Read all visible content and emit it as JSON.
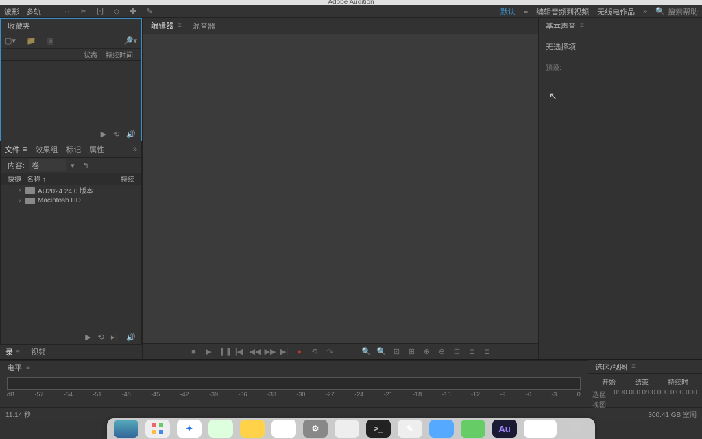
{
  "app_title": "Adobe Audition",
  "toolbar": {
    "mode_waveform": "波形",
    "mode_multitrack": "多轨",
    "workspace_default": "默认",
    "workspace_edit_video": "编辑音频到视频",
    "workspace_radio": "无线电作品",
    "search_help_placeholder": "搜索帮助"
  },
  "favorites": {
    "title": "收藏夹",
    "col_status": "状态",
    "col_duration": "持续时间"
  },
  "files": {
    "tab_files": "文件",
    "tab_effects": "效果组",
    "tab_markers": "标记",
    "tab_properties": "属性",
    "content_label": "内容:",
    "content_value": "卷",
    "col_quick": "快捷",
    "col_name": "名称 ↑",
    "col_duration": "持续",
    "rows": [
      {
        "name": "AU2024 24.0 版本"
      },
      {
        "name": "Macintosh HD"
      }
    ]
  },
  "left_bottom": {
    "tab_history": "录",
    "tab_video": "视频"
  },
  "center": {
    "tab_editor": "编辑器",
    "tab_mixer": "混音器"
  },
  "levels": {
    "title": "电平",
    "ticks": [
      "dB",
      "-57",
      "-54",
      "-51",
      "-48",
      "-45",
      "-42",
      "-39",
      "-36",
      "-33",
      "-30",
      "-27",
      "-24",
      "-21",
      "-18",
      "-15",
      "-12",
      "-9",
      "-6",
      "-3",
      "0"
    ]
  },
  "right": {
    "title": "基本声音",
    "no_selection": "无选择项",
    "preset_label": "预设:"
  },
  "selview": {
    "title": "选区/视图",
    "col_start": "开始",
    "col_end": "结束",
    "col_duration": "持续时",
    "row_sel": "选区",
    "row_view": "视图",
    "zero": "0:00.000"
  },
  "status": {
    "left": "11.14 秒",
    "right": "300.41 GB 空闲"
  },
  "dock": {
    "au": "Au"
  }
}
